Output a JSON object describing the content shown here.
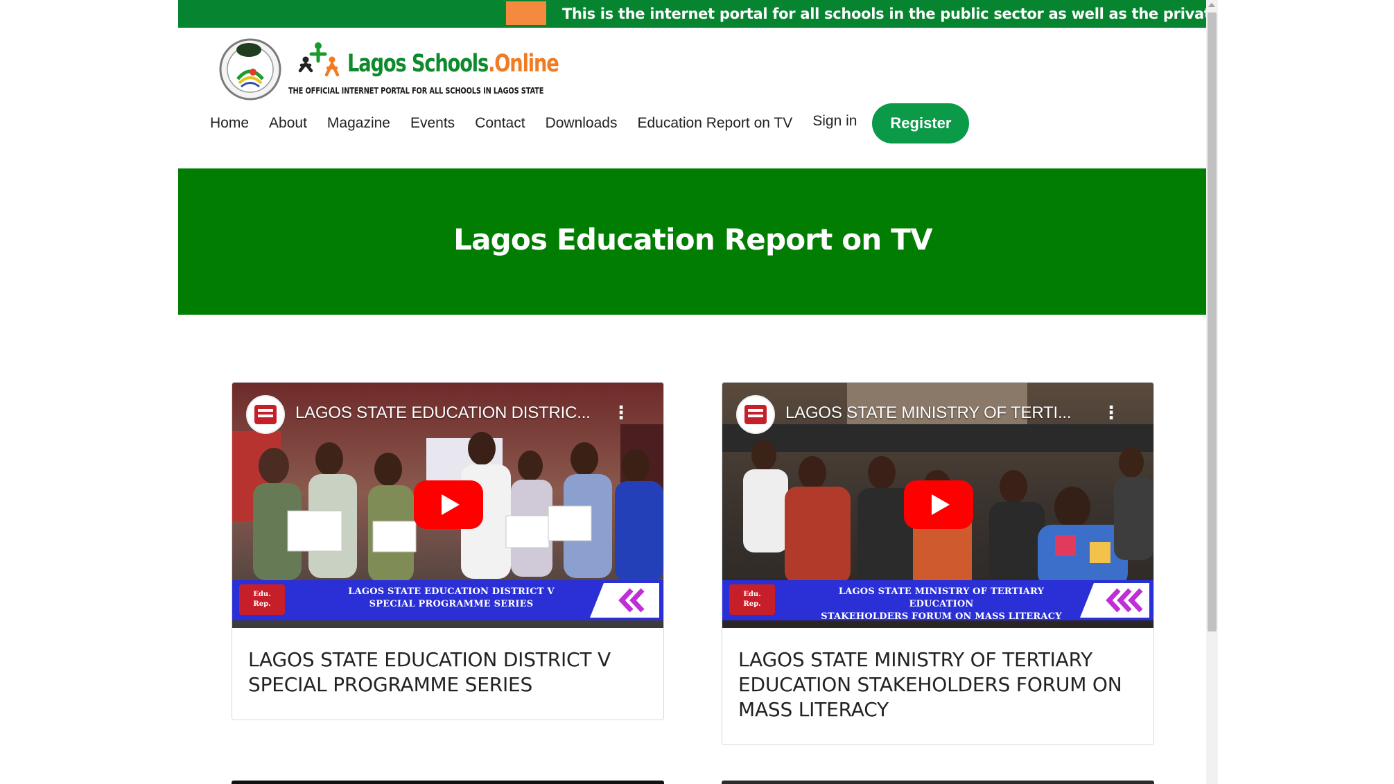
{
  "ticker": {
    "text": "This is the internet portal for all schools in the public sector as well as the private sector in L"
  },
  "brand": {
    "name_part1": "Lagos Schools",
    "name_part2": ".Online",
    "tagline": "THE OFFICIAL INTERNET PORTAL FOR ALL SCHOOLS IN LAGOS STATE"
  },
  "nav": {
    "items": [
      "Home",
      "About",
      "Magazine",
      "Events",
      "Contact",
      "Downloads",
      "Education Report on TV"
    ],
    "sign_in": "Sign in",
    "register": "Register"
  },
  "hero": {
    "title": "Lagos Education Report on TV"
  },
  "videos": [
    {
      "thumb_title": "LAGOS STATE EDUCATION DISTRIC...",
      "lower_third_line1": "LAGOS STATE EDUCATION DISTRICT V",
      "lower_third_line2": "SPECIAL PROGRAMME SERIES",
      "title": "LAGOS STATE EDUCATION DISTRICT V SPECIAL PROGRAMME SERIES"
    },
    {
      "thumb_title": "LAGOS STATE MINISTRY OF TERTI...",
      "lower_third_line1": "LAGOS STATE MINISTRY OF TERTIARY EDUCATION",
      "lower_third_line2": "STAKEHOLDERS FORUM ON MASS LITERACY",
      "title": "LAGOS STATE MINISTRY OF TERTIARY EDUCATION STAKEHOLDERS FORUM ON MASS LITERACY"
    }
  ],
  "colors": {
    "ticker_green": "#078430",
    "hero_green": "#017e02",
    "register_green": "#0a9a48",
    "accent_orange": "#f58a3f",
    "youtube_red": "#ff0000"
  },
  "icons": {
    "crest": "lagos-state-crest-icon",
    "brand_mark": "lagos-schools-logo-icon",
    "play": "youtube-play-icon",
    "menu": "kebab-menu-icon"
  }
}
